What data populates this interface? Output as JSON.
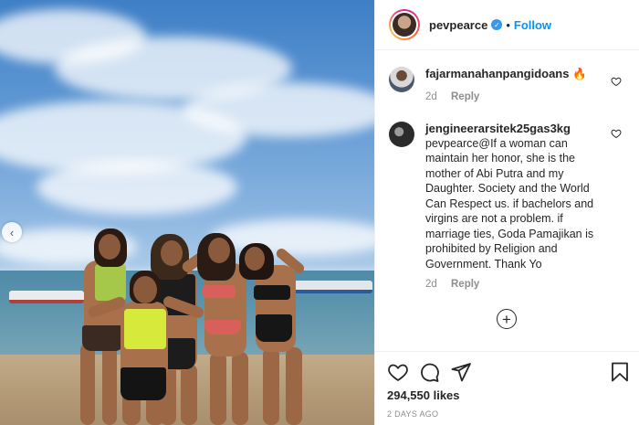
{
  "post": {
    "username": "pevpearce",
    "follow_label": "Follow",
    "separator": "•",
    "likes": "294,550 likes",
    "date": "2 DAYS AGO"
  },
  "comments": [
    {
      "user": "fajarmanahanpangidoans",
      "text": "🔥",
      "age": "2d",
      "reply_label": "Reply"
    },
    {
      "user": "jengineerarsitek25gas3kg",
      "text": "pevpearce@If a woman can maintain her honor, she is the mother of Abi Putra and my Daughter. Society and the World Can Respect us. if bachelors and virgins are not a problem. if marriage ties, Goda Pamajikan is prohibited by Religion and Government. Thank Yo",
      "age": "2d",
      "reply_label": "Reply"
    }
  ],
  "icons": {
    "verified": "verified-badge-icon",
    "carousel_prev": "chevron-left-icon",
    "load_more": "plus-circle-icon",
    "like": "heart-icon",
    "comment": "comment-icon",
    "share": "paper-plane-icon",
    "save": "bookmark-icon"
  },
  "colors": {
    "accent": "#0095f6",
    "verified": "#3897f0",
    "muted": "#8e8e8e",
    "text": "#262626"
  }
}
